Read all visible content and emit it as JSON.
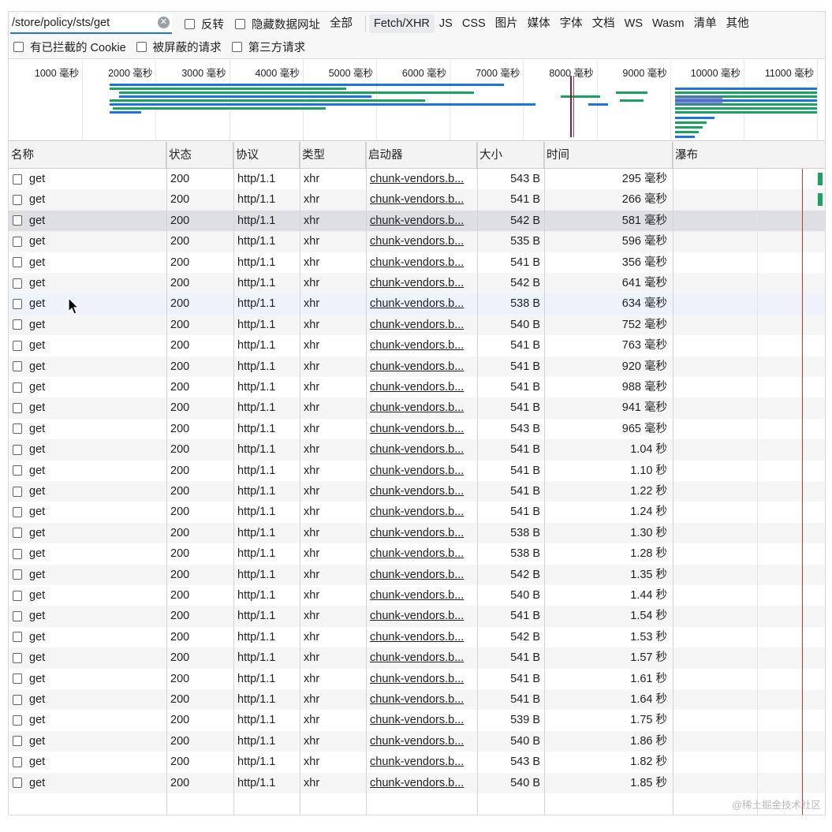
{
  "filter": {
    "value": "/store/policy/sts/get"
  },
  "toolbar1": {
    "invert_label": "反转",
    "hide_data_urls_label": "隐藏数据网址",
    "types": [
      "全部",
      "Fetch/XHR",
      "JS",
      "CSS",
      "图片",
      "媒体",
      "字体",
      "文档",
      "WS",
      "Wasm",
      "清单",
      "其他"
    ],
    "active_type": "Fetch/XHR"
  },
  "toolbar2": {
    "blocked_cookies_label": "有已拦截的 Cookie",
    "blocked_requests_label": "被屏蔽的请求",
    "third_party_label": "第三方请求"
  },
  "overview": {
    "ticks": [
      "1000 毫秒",
      "2000 毫秒",
      "3000 毫秒",
      "4000 毫秒",
      "5000 毫秒",
      "6000 毫秒",
      "7000 毫秒",
      "8000 毫秒",
      "9000 毫秒",
      "10000 毫秒",
      "11000 毫秒"
    ]
  },
  "columns": {
    "name": "名称",
    "status": "状态",
    "protocol": "协议",
    "type": "类型",
    "initiator": "启动器",
    "size": "大小",
    "time": "时间",
    "waterfall": "瀑布"
  },
  "rows": [
    {
      "name": "get",
      "status": "200",
      "protocol": "http/1.1",
      "type": "xhr",
      "initiator": "chunk-vendors.b...",
      "size": "543 B",
      "time": "295 毫秒"
    },
    {
      "name": "get",
      "status": "200",
      "protocol": "http/1.1",
      "type": "xhr",
      "initiator": "chunk-vendors.b...",
      "size": "541 B",
      "time": "266 毫秒"
    },
    {
      "name": "get",
      "status": "200",
      "protocol": "http/1.1",
      "type": "xhr",
      "initiator": "chunk-vendors.b...",
      "size": "542 B",
      "time": "581 毫秒"
    },
    {
      "name": "get",
      "status": "200",
      "protocol": "http/1.1",
      "type": "xhr",
      "initiator": "chunk-vendors.b...",
      "size": "535 B",
      "time": "596 毫秒"
    },
    {
      "name": "get",
      "status": "200",
      "protocol": "http/1.1",
      "type": "xhr",
      "initiator": "chunk-vendors.b...",
      "size": "541 B",
      "time": "356 毫秒"
    },
    {
      "name": "get",
      "status": "200",
      "protocol": "http/1.1",
      "type": "xhr",
      "initiator": "chunk-vendors.b...",
      "size": "542 B",
      "time": "641 毫秒"
    },
    {
      "name": "get",
      "status": "200",
      "protocol": "http/1.1",
      "type": "xhr",
      "initiator": "chunk-vendors.b...",
      "size": "538 B",
      "time": "634 毫秒"
    },
    {
      "name": "get",
      "status": "200",
      "protocol": "http/1.1",
      "type": "xhr",
      "initiator": "chunk-vendors.b...",
      "size": "540 B",
      "time": "752 毫秒"
    },
    {
      "name": "get",
      "status": "200",
      "protocol": "http/1.1",
      "type": "xhr",
      "initiator": "chunk-vendors.b...",
      "size": "541 B",
      "time": "763 毫秒"
    },
    {
      "name": "get",
      "status": "200",
      "protocol": "http/1.1",
      "type": "xhr",
      "initiator": "chunk-vendors.b...",
      "size": "541 B",
      "time": "920 毫秒"
    },
    {
      "name": "get",
      "status": "200",
      "protocol": "http/1.1",
      "type": "xhr",
      "initiator": "chunk-vendors.b...",
      "size": "541 B",
      "time": "988 毫秒"
    },
    {
      "name": "get",
      "status": "200",
      "protocol": "http/1.1",
      "type": "xhr",
      "initiator": "chunk-vendors.b...",
      "size": "541 B",
      "time": "941 毫秒"
    },
    {
      "name": "get",
      "status": "200",
      "protocol": "http/1.1",
      "type": "xhr",
      "initiator": "chunk-vendors.b...",
      "size": "543 B",
      "time": "965 毫秒"
    },
    {
      "name": "get",
      "status": "200",
      "protocol": "http/1.1",
      "type": "xhr",
      "initiator": "chunk-vendors.b...",
      "size": "541 B",
      "time": "1.04 秒"
    },
    {
      "name": "get",
      "status": "200",
      "protocol": "http/1.1",
      "type": "xhr",
      "initiator": "chunk-vendors.b...",
      "size": "541 B",
      "time": "1.10 秒"
    },
    {
      "name": "get",
      "status": "200",
      "protocol": "http/1.1",
      "type": "xhr",
      "initiator": "chunk-vendors.b...",
      "size": "541 B",
      "time": "1.22 秒"
    },
    {
      "name": "get",
      "status": "200",
      "protocol": "http/1.1",
      "type": "xhr",
      "initiator": "chunk-vendors.b...",
      "size": "541 B",
      "time": "1.24 秒"
    },
    {
      "name": "get",
      "status": "200",
      "protocol": "http/1.1",
      "type": "xhr",
      "initiator": "chunk-vendors.b...",
      "size": "538 B",
      "time": "1.30 秒"
    },
    {
      "name": "get",
      "status": "200",
      "protocol": "http/1.1",
      "type": "xhr",
      "initiator": "chunk-vendors.b...",
      "size": "538 B",
      "time": "1.28 秒"
    },
    {
      "name": "get",
      "status": "200",
      "protocol": "http/1.1",
      "type": "xhr",
      "initiator": "chunk-vendors.b...",
      "size": "542 B",
      "time": "1.35 秒"
    },
    {
      "name": "get",
      "status": "200",
      "protocol": "http/1.1",
      "type": "xhr",
      "initiator": "chunk-vendors.b...",
      "size": "540 B",
      "time": "1.44 秒"
    },
    {
      "name": "get",
      "status": "200",
      "protocol": "http/1.1",
      "type": "xhr",
      "initiator": "chunk-vendors.b...",
      "size": "541 B",
      "time": "1.54 秒"
    },
    {
      "name": "get",
      "status": "200",
      "protocol": "http/1.1",
      "type": "xhr",
      "initiator": "chunk-vendors.b...",
      "size": "542 B",
      "time": "1.53 秒"
    },
    {
      "name": "get",
      "status": "200",
      "protocol": "http/1.1",
      "type": "xhr",
      "initiator": "chunk-vendors.b...",
      "size": "541 B",
      "time": "1.57 秒"
    },
    {
      "name": "get",
      "status": "200",
      "protocol": "http/1.1",
      "type": "xhr",
      "initiator": "chunk-vendors.b...",
      "size": "541 B",
      "time": "1.61 秒"
    },
    {
      "name": "get",
      "status": "200",
      "protocol": "http/1.1",
      "type": "xhr",
      "initiator": "chunk-vendors.b...",
      "size": "541 B",
      "time": "1.64 秒"
    },
    {
      "name": "get",
      "status": "200",
      "protocol": "http/1.1",
      "type": "xhr",
      "initiator": "chunk-vendors.b...",
      "size": "539 B",
      "time": "1.75 秒"
    },
    {
      "name": "get",
      "status": "200",
      "protocol": "http/1.1",
      "type": "xhr",
      "initiator": "chunk-vendors.b...",
      "size": "540 B",
      "time": "1.86 秒"
    },
    {
      "name": "get",
      "status": "200",
      "protocol": "http/1.1",
      "type": "xhr",
      "initiator": "chunk-vendors.b...",
      "size": "543 B",
      "time": "1.82 秒"
    },
    {
      "name": "get",
      "status": "200",
      "protocol": "http/1.1",
      "type": "xhr",
      "initiator": "chunk-vendors.b...",
      "size": "540 B",
      "time": "1.85 秒"
    }
  ],
  "selected_row": 2,
  "hover_row": 6,
  "watermark": "@稀土掘金技术社区",
  "colors": {
    "accent": "#1a73e8",
    "waterfall_green": "#1aa260",
    "waterfall_blue": "#1a73e8",
    "load_line": "#c0392b"
  }
}
